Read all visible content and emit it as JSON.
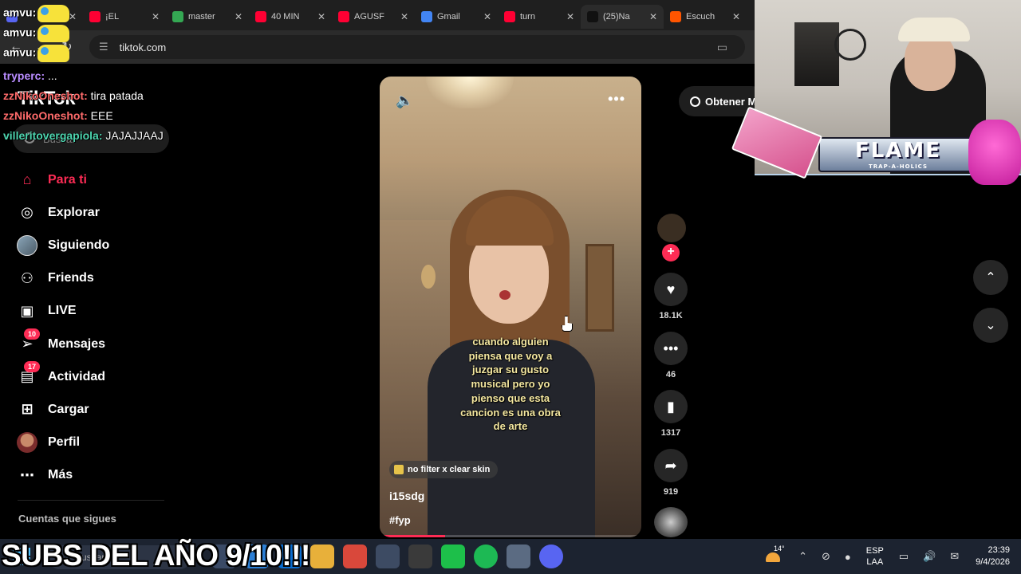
{
  "browser": {
    "tabs": [
      {
        "title": "",
        "favicon": "discord-icon",
        "color": "#5865f2"
      },
      {
        "title": "¡EL",
        "favicon": "youtube-icon",
        "color": "#ff0033"
      },
      {
        "title": "master",
        "favicon": "drive-icon",
        "color": "#34a853"
      },
      {
        "title": "40 MIN",
        "favicon": "youtube-icon",
        "color": "#ff0033"
      },
      {
        "title": "AGUSF",
        "favicon": "youtube-icon",
        "color": "#ff0033"
      },
      {
        "title": "Gmail",
        "favicon": "google-icon",
        "color": "#4285f4"
      },
      {
        "title": "turn",
        "favicon": "youtube-icon",
        "color": "#ff0033"
      },
      {
        "title": "(25)Na",
        "favicon": "tiktok-icon",
        "color": "#111111"
      },
      {
        "title": "Escuch",
        "favicon": "soundcloud-icon",
        "color": "#ff5500"
      }
    ],
    "url": "tiktok.com"
  },
  "chat": [
    {
      "user": "amvu:",
      "message": "",
      "color": "#ffffff",
      "emote": true
    },
    {
      "user": "amvu:",
      "message": "",
      "color": "#ffffff",
      "emote": true
    },
    {
      "user": "amvu:",
      "message": "",
      "color": "#ffffff",
      "emote": true
    },
    {
      "user": "tryperc:",
      "message": " ...",
      "color": "#b98cff"
    },
    {
      "user": "zzNikoOneshot:",
      "message": " tira patada",
      "color": "#ff6b6b"
    },
    {
      "user": "zzNikoOneshot:",
      "message": " EEE",
      "color": "#ff6b6b"
    },
    {
      "user": "villeritovergapiola:",
      "message": " JAJAJJAAJ",
      "color": "#4ed6b0"
    }
  ],
  "tiktok": {
    "logo": "TikTok",
    "search_placeholder": "Buscar",
    "menu": [
      {
        "label": "Para ti",
        "icon": "home-icon",
        "active": true
      },
      {
        "label": "Explorar",
        "icon": "compass-icon"
      },
      {
        "label": "Siguiendo",
        "icon": "following-avatar-icon"
      },
      {
        "label": "Friends",
        "icon": "friends-icon"
      },
      {
        "label": "LIVE",
        "icon": "live-tv-icon"
      },
      {
        "label": "Mensajes",
        "icon": "messages-icon",
        "badge": "10"
      },
      {
        "label": "Actividad",
        "icon": "activity-icon",
        "badge": "17"
      },
      {
        "label": "Cargar",
        "icon": "upload-icon"
      },
      {
        "label": "Perfil",
        "icon": "profile-avatar-icon"
      },
      {
        "label": "Más",
        "icon": "more-icon"
      }
    ],
    "following_title": "Cuentas que sigues",
    "get_app": "Obtener M",
    "video": {
      "caption": "cuando alguien piensa que voy a juzgar su gusto musical pero yo pienso que esta cancion es una obra de arte",
      "music": "no filter x clear skin",
      "username": "i15sdg",
      "hashtag": "#fyp",
      "progress": 0.25
    },
    "actions": {
      "likes": "18.1K",
      "comments": "46",
      "saves": "1317",
      "shares": "919"
    }
  },
  "webcam": {
    "banner": "FLAME",
    "banner_sub": "TRAP-A-HOLICS"
  },
  "overlay_text": "SUBS DEL AÑO 9/10!!!",
  "taskbar": {
    "search_placeholder": "Buscar",
    "temperature": "14°",
    "language": "ESP",
    "layout": "LAA",
    "time": "23:39",
    "date": "9/4/2026"
  },
  "colors": {
    "accent": "#fe2c55",
    "caption": "#f5e8a0"
  }
}
